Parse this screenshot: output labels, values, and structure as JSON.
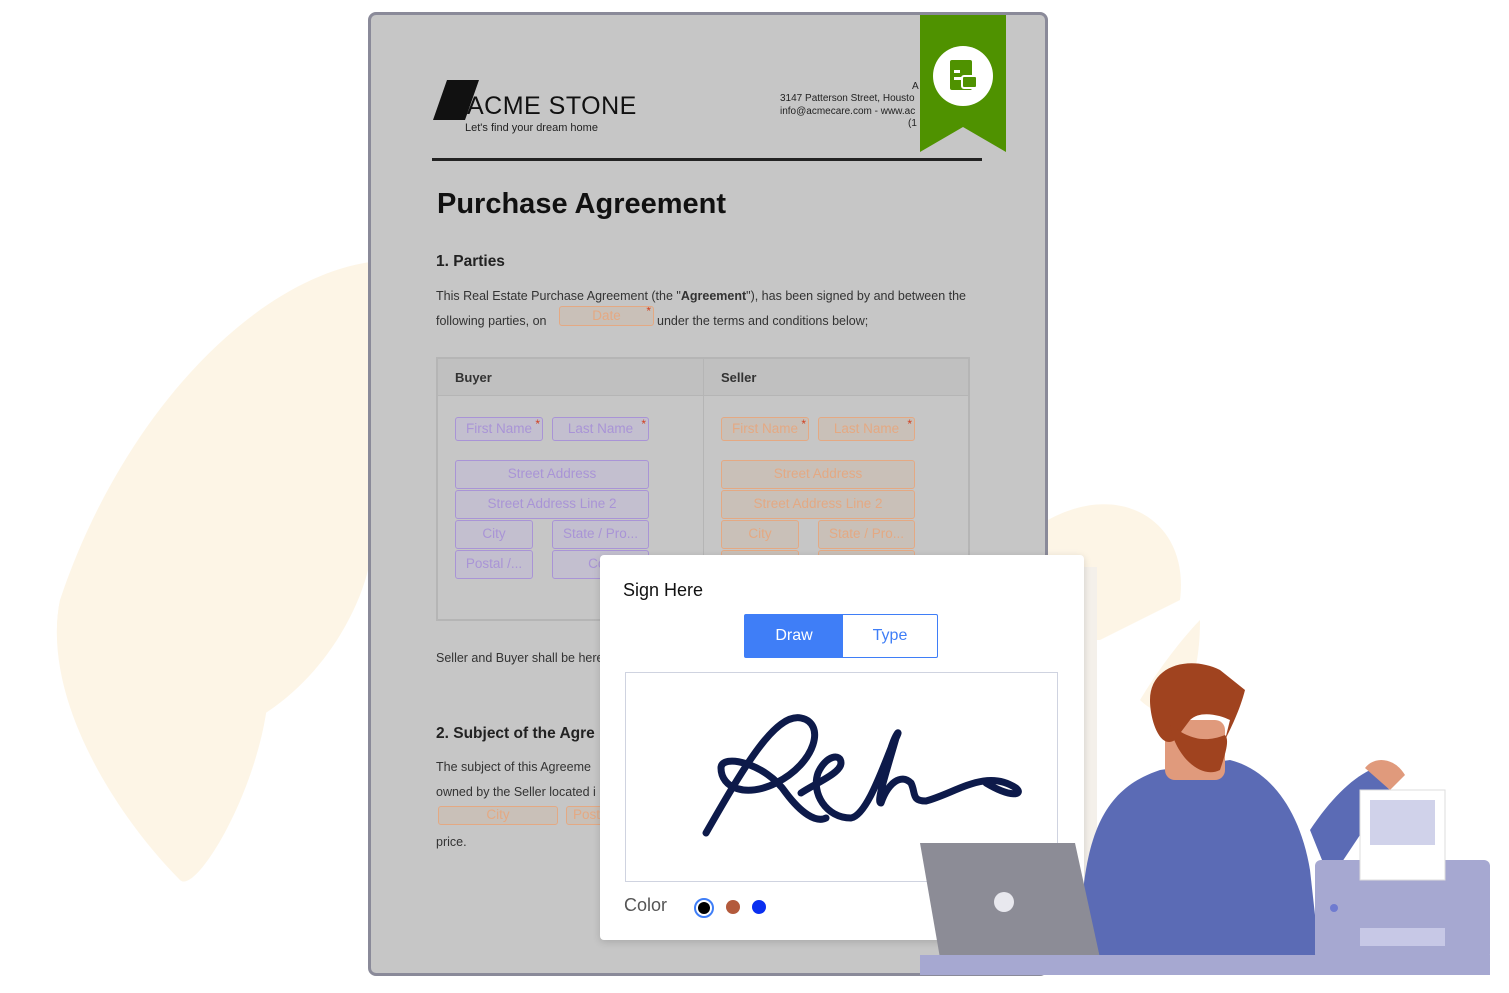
{
  "brand": {
    "name": "ACME STONE",
    "tagline": "Let's find your dream home",
    "address_line1": "3147 Patterson Street, Housto",
    "address_line2": "info@acmecare.com - www.ac",
    "address_top": "A",
    "address_line3": "(1"
  },
  "document": {
    "title": "Purchase Agreement",
    "section1": "1. Parties",
    "intro_a": "This Real Estate Purchase Agreement (the \"",
    "intro_bold": "Agreement",
    "intro_b": "\"), has been signed by and between the",
    "intro_c": "following parties, on",
    "intro_d": "under the terms and conditions below;",
    "date_placeholder": "Date",
    "buyer_header": "Buyer",
    "seller_header": "Seller",
    "fields": {
      "first_name": "First Name",
      "last_name": "Last Name",
      "street": "Street Address",
      "street2": "Street Address Line 2",
      "city": "City",
      "state": "State / Pro...",
      "postal": "Postal /...",
      "country": "Cou"
    },
    "after_table": "Seller and Buyer shall be here",
    "section2": "2. Subject of the Agre",
    "s2_line1": "The subject of this Agreeme",
    "s2_line2": "owned by the Seller located i",
    "s2_city": "City",
    "s2_postal": "Post",
    "s2_end": "price."
  },
  "sign_modal": {
    "title": "Sign Here",
    "tabs": [
      {
        "label": "Draw",
        "active": true
      },
      {
        "label": "Type",
        "active": false
      }
    ],
    "color_label": "Color",
    "colors": [
      "#000000",
      "#b35a3c",
      "#0a2ff0"
    ],
    "selected_color": "#000000"
  },
  "colors": {
    "accent": "#3f7ef7",
    "ribbon": "#4f9200",
    "signature": "#0d1a4a"
  }
}
